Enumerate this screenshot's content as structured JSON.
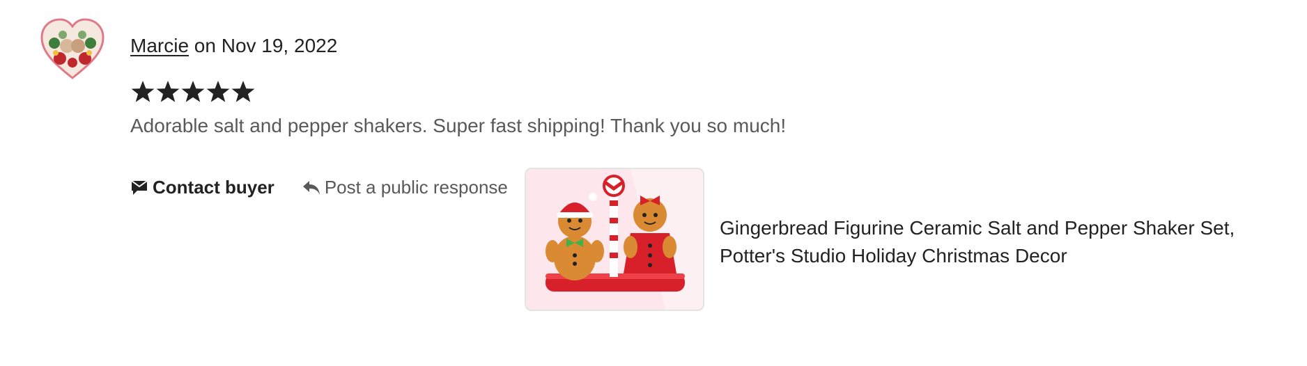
{
  "review": {
    "reviewer_name": "Marcie",
    "date_text": " on Nov 19, 2022",
    "rating": 5,
    "rating_max": 5,
    "text": "Adorable salt and pepper shakers. Super fast shipping! Thank you so much!",
    "avatar_icon": "heart-wreath-avatar"
  },
  "actions": {
    "contact_label": "Contact buyer",
    "contact_icon": "envelope-flag-icon",
    "respond_label": "Post a public response",
    "respond_icon": "reply-arrow-icon"
  },
  "listing": {
    "title": "Gingerbread Figurine Ceramic Salt and Pepper Shaker Set, Potter's Studio Holiday Christmas Decor",
    "thumb_icon": "gingerbread-shakers-image"
  },
  "colors": {
    "text": "#222222",
    "muted": "#595959",
    "star": "#222222",
    "thumb_bg": "#fde6ec"
  }
}
